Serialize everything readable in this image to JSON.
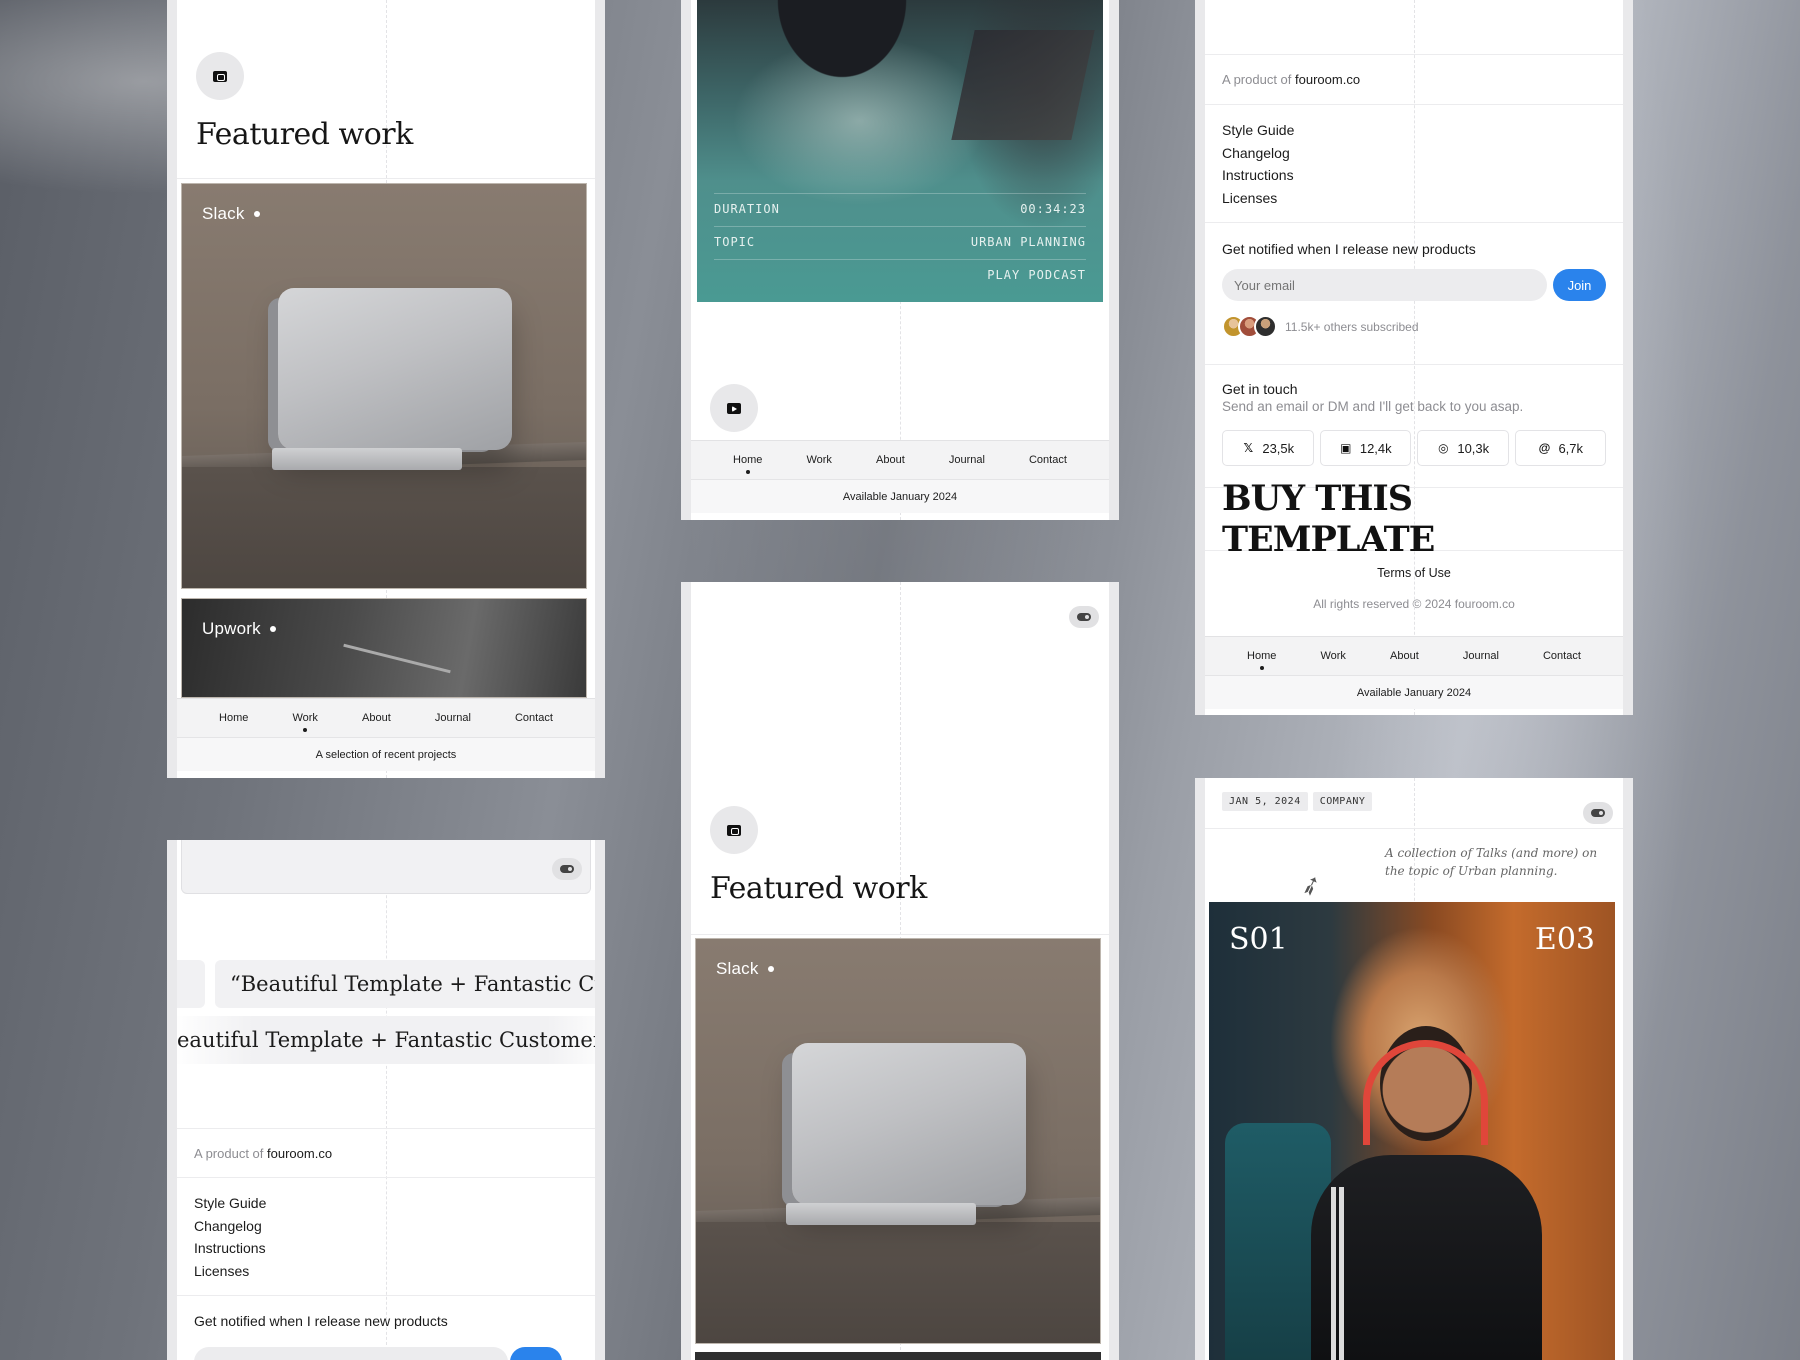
{
  "nav": {
    "items": [
      "Home",
      "Work",
      "About",
      "Journal",
      "Contact"
    ]
  },
  "panel_work": {
    "title": "Featured work",
    "projects": [
      {
        "label": "Slack"
      },
      {
        "label": "Upwork"
      }
    ],
    "active_nav": "Work",
    "caption": "A selection of recent projects"
  },
  "panel_podcast": {
    "rows": [
      {
        "key": "DURATION",
        "value": "00:34:23"
      },
      {
        "key": "TOPIC",
        "value": "URBAN PLANNING"
      }
    ],
    "play_label": "PLAY PODCAST",
    "active_nav": "Home",
    "caption": "Available January 2024"
  },
  "panel_footer": {
    "product_prefix": "A product of",
    "product_link": "fouroom.co",
    "links": [
      "Style Guide",
      "Changelog",
      "Instructions",
      "Licenses"
    ],
    "notify_heading": "Get notified when I release new products",
    "email_placeholder": "Your email",
    "join_label": "Join",
    "subscribers": "11.5k+ others subscribed",
    "contact_heading": "Get in touch",
    "contact_sub": "Send an email or DM and I'll get back to you asap.",
    "socials": [
      {
        "icon": "x-icon",
        "count": "23,5k"
      },
      {
        "icon": "linkedin-icon",
        "count": "12,4k"
      },
      {
        "icon": "instagram-icon",
        "count": "10,3k"
      },
      {
        "icon": "threads-icon",
        "count": "6,7k"
      }
    ],
    "buy_label": "BUY THIS TEMPLATE",
    "terms": "Terms of Use",
    "rights": "All rights reserved © 2024 fouroom.co",
    "active_nav": "Home",
    "caption": "Available January 2024"
  },
  "panel_testimonial": {
    "quote_line1": "“Beautiful Template + Fantastic Custo",
    "quote_line2": "eautiful Template + Fantastic Customer serv",
    "product_prefix": "A product of",
    "product_link": "fouroom.co",
    "links": [
      "Style Guide",
      "Changelog",
      "Instructions",
      "Licenses"
    ],
    "notify_heading": "Get notified when I release new products"
  },
  "panel_work2": {
    "title": "Featured work",
    "projects": [
      {
        "label": "Slack"
      }
    ]
  },
  "panel_episode": {
    "date_tag": "JAN 5, 2024",
    "category_tag": "COMPANY",
    "note": "A collection of Talks (and more) on the topic of Urban planning.",
    "season": "S01",
    "episode": "E03"
  },
  "colors": {
    "accent_blue": "#2a83ec",
    "teal": "#4a9a93"
  }
}
